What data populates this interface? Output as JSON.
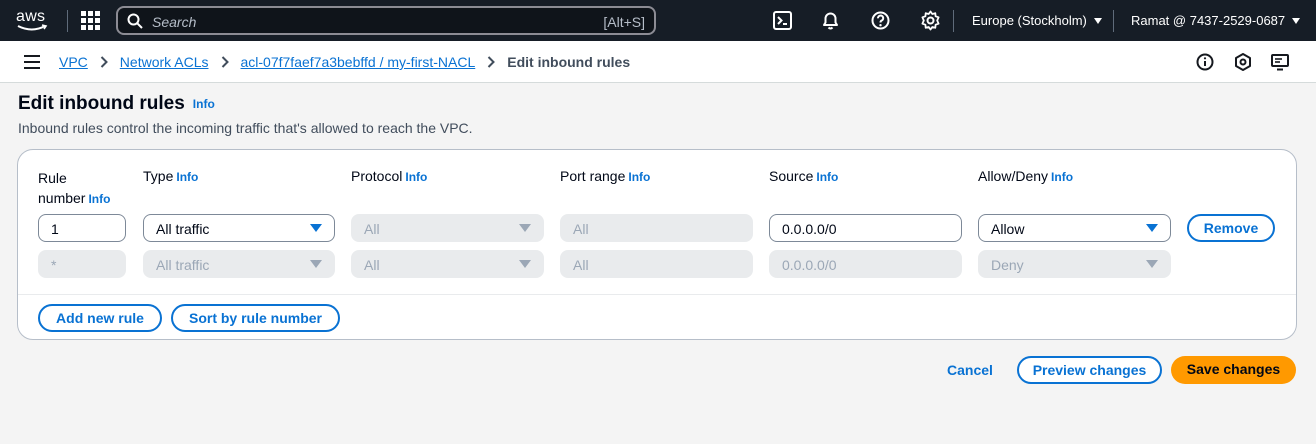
{
  "topnav": {
    "logo_text": "aws",
    "search_placeholder": "Search",
    "search_shortcut": "[Alt+S]",
    "icons": [
      "grid-icon",
      "cloudshell-icon",
      "bell-icon",
      "help-icon",
      "gear-icon"
    ],
    "region": "Europe (Stockholm)",
    "account": "Ramat @ 7437-2529-0687"
  },
  "breadcrumb": {
    "items": [
      "VPC",
      "Network ACLs",
      "acl-07f7faef7a3bebffd / my-first-NACL"
    ],
    "current": "Edit inbound rules"
  },
  "page": {
    "title": "Edit inbound rules",
    "info": "Info",
    "description": "Inbound rules control the incoming traffic that's allowed to reach the VPC."
  },
  "table": {
    "headers": {
      "rule_number_line1": "Rule",
      "rule_number_line2": "number",
      "type": "Type",
      "protocol": "Protocol",
      "port_range": "Port range",
      "source": "Source",
      "allow_deny": "Allow/Deny",
      "info": "Info"
    },
    "rows": [
      {
        "rule_number": "1",
        "type": "All traffic",
        "protocol": "All",
        "port_range": "All",
        "source": "0.0.0.0/0",
        "allow_deny": "Allow",
        "remove": "Remove"
      },
      {
        "rule_number": "*",
        "type": "All traffic",
        "protocol": "All",
        "port_range": "All",
        "source": "0.0.0.0/0",
        "allow_deny": "Deny"
      }
    ],
    "add_rule": "Add new rule",
    "sort_rule": "Sort by rule number"
  },
  "footer": {
    "cancel": "Cancel",
    "preview": "Preview changes",
    "save": "Save changes"
  },
  "colors": {
    "nav_bg": "#161d26",
    "link": "#0972d3",
    "primary": "#ff9900"
  }
}
